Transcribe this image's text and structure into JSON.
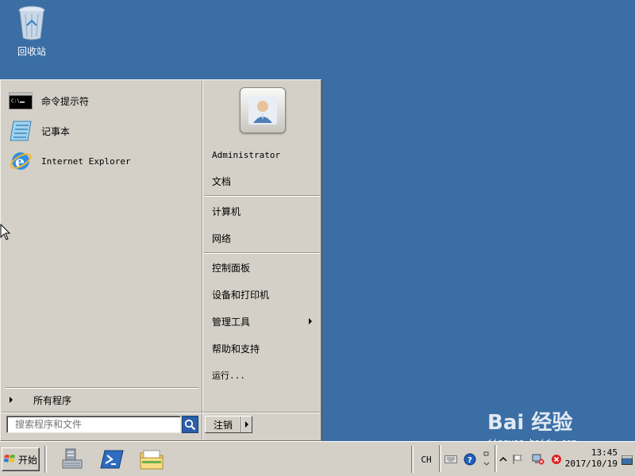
{
  "desktop": {
    "recycle_bin_label": "回收站",
    "watermark_brand": "Bai 经验",
    "watermark_url": "jingyan.baidu.com"
  },
  "start_menu": {
    "pinned": [
      {
        "label": "命令提示符",
        "icon": "cmd-icon"
      },
      {
        "label": "记事本",
        "icon": "notepad-icon"
      },
      {
        "label": "Internet Explorer",
        "icon": "ie-icon"
      }
    ],
    "all_programs_label": "所有程序",
    "search_placeholder": "搜索程序和文件",
    "logoff_label": "注销",
    "right": {
      "user_name": "Administrator",
      "items_group1": [
        "文档"
      ],
      "items_group2": [
        "计算机",
        "网络"
      ],
      "items_group3": [
        "控制面板",
        "设备和打印机",
        "管理工具",
        "帮助和支持",
        "运行..."
      ]
    }
  },
  "taskbar": {
    "start_label": "开始",
    "apps": [
      "server-manager-icon",
      "powershell-icon",
      "explorer-folder-icon"
    ],
    "language": "CH",
    "clock_time": "13:45",
    "clock_date": "2017/10/19"
  },
  "colors": {
    "desktop": "#3a6ea5",
    "panel": "#d4d0c8"
  }
}
